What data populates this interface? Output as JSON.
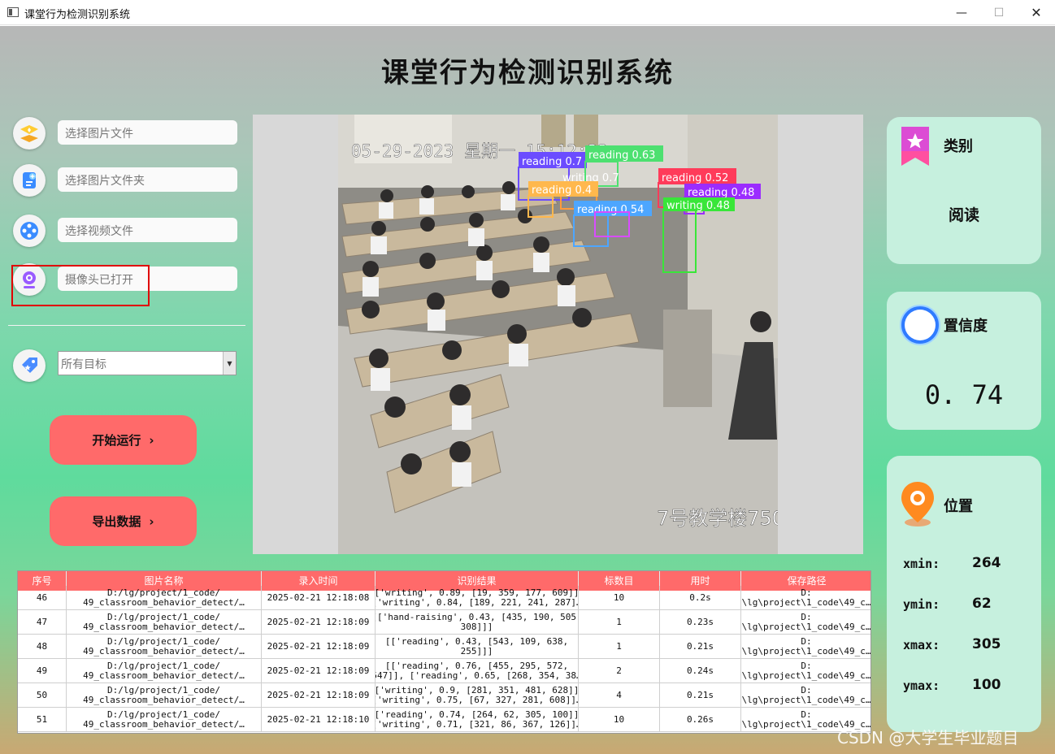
{
  "window": {
    "title": "课堂行为检测识别系统",
    "min": "—",
    "max": "☐",
    "close": "✕"
  },
  "app_title": "课堂行为检测识别系统",
  "sidebar": {
    "image_file": {
      "placeholder": "选择图片文件",
      "icon": "layers-icon"
    },
    "image_folder": {
      "placeholder": "选择图片文件夹",
      "icon": "add-file-icon"
    },
    "video_file": {
      "placeholder": "选择视频文件",
      "icon": "film-reel-icon"
    },
    "camera": {
      "placeholder": "摄像头已打开",
      "icon": "webcam-icon"
    },
    "target_select": {
      "value": "所有目标",
      "icon": "tag-icon"
    },
    "run_button": "开始运行 ",
    "export_button": "导出数据 ",
    "chevron": "›"
  },
  "video": {
    "timestamp": "05-29-2023 星期一 15:12:22",
    "location": "7号教学楼7506前",
    "detections": [
      {
        "label": "reading 0.7",
        "color": "#6b4cff"
      },
      {
        "label": "reading 0.63",
        "color": "#4de070"
      },
      {
        "label": "writing 0.7",
        "color": "#ff9a3c"
      },
      {
        "label": "reading 0.52",
        "color": "#ff3b5a"
      },
      {
        "label": "reading 0.48",
        "color": "#9b2cff"
      },
      {
        "label": "reading 0.4",
        "color": "#ffb84d"
      },
      {
        "label": "reading 0.54",
        "color": "#4da6ff"
      },
      {
        "label": "writing 0.48",
        "color": "#39e639"
      }
    ]
  },
  "cards": {
    "category": {
      "title": "类别",
      "value": "阅读",
      "icon": "bookmark-star-icon"
    },
    "confidence": {
      "title": "置信度",
      "value": "0. 74",
      "icon": "ring-icon"
    },
    "position": {
      "title": "位置",
      "icon": "map-pin-icon",
      "xmin_label": "xmin:",
      "xmin": "264",
      "ymin_label": "ymin:",
      "ymin": "62",
      "xmax_label": "xmax:",
      "xmax": "305",
      "ymax_label": "ymax:",
      "ymax": "100"
    }
  },
  "table": {
    "headers": [
      "序号",
      "图片名称",
      "录入时间",
      "识别结果",
      "标数目",
      "用时",
      "保存路径"
    ],
    "rows": [
      {
        "id": "46",
        "name": "D:/lg/project/1_code/\n49_classroom_behavior_detect/…",
        "time": "2025-02-21 12:18:08",
        "result": "[['writing', 0.89, [19, 359, 177, 609]],\n['writing', 0.84, [189, 221, 241, 287]…",
        "count": "10",
        "elapsed": "0.2s",
        "path": "D:\n\\lg\\project\\1_code\\49_c…"
      },
      {
        "id": "47",
        "name": "D:/lg/project/1_code/\n49_classroom_behavior_detect/…",
        "time": "2025-02-21 12:18:09",
        "result": "[['hand-raising', 0.43, [435, 190, 505,\n308]]]",
        "count": "1",
        "elapsed": "0.23s",
        "path": "D:\n\\lg\\project\\1_code\\49_c…"
      },
      {
        "id": "48",
        "name": "D:/lg/project/1_code/\n49_classroom_behavior_detect/…",
        "time": "2025-02-21 12:18:09",
        "result": "[['reading', 0.43, [543, 109, 638,\n255]]]",
        "count": "1",
        "elapsed": "0.21s",
        "path": "D:\n\\lg\\project\\1_code\\49_c…"
      },
      {
        "id": "49",
        "name": "D:/lg/project/1_code/\n49_classroom_behavior_detect/…",
        "time": "2025-02-21 12:18:09",
        "result": "[['reading', 0.76, [455, 295, 572,\n547]], ['reading', 0.65, [268, 354, 38…",
        "count": "2",
        "elapsed": "0.24s",
        "path": "D:\n\\lg\\project\\1_code\\49_c…"
      },
      {
        "id": "50",
        "name": "D:/lg/project/1_code/\n49_classroom_behavior_detect/…",
        "time": "2025-02-21 12:18:09",
        "result": "[['writing', 0.9, [281, 351, 481, 628]],\n['writing', 0.75, [67, 327, 281, 608]]…",
        "count": "4",
        "elapsed": "0.21s",
        "path": "D:\n\\lg\\project\\1_code\\49_c…"
      },
      {
        "id": "51",
        "name": "D:/lg/project/1_code/\n49_classroom_behavior_detect/…",
        "time": "2025-02-21 12:18:10",
        "result": "[['reading', 0.74, [264, 62, 305, 100]],\n['writing', 0.71, [321, 86, 367, 126]]…",
        "count": "10",
        "elapsed": "0.26s",
        "path": "D:\n\\lg\\project\\1_code\\49_c…"
      }
    ]
  },
  "watermark": "CSDN @大学生毕业题目"
}
